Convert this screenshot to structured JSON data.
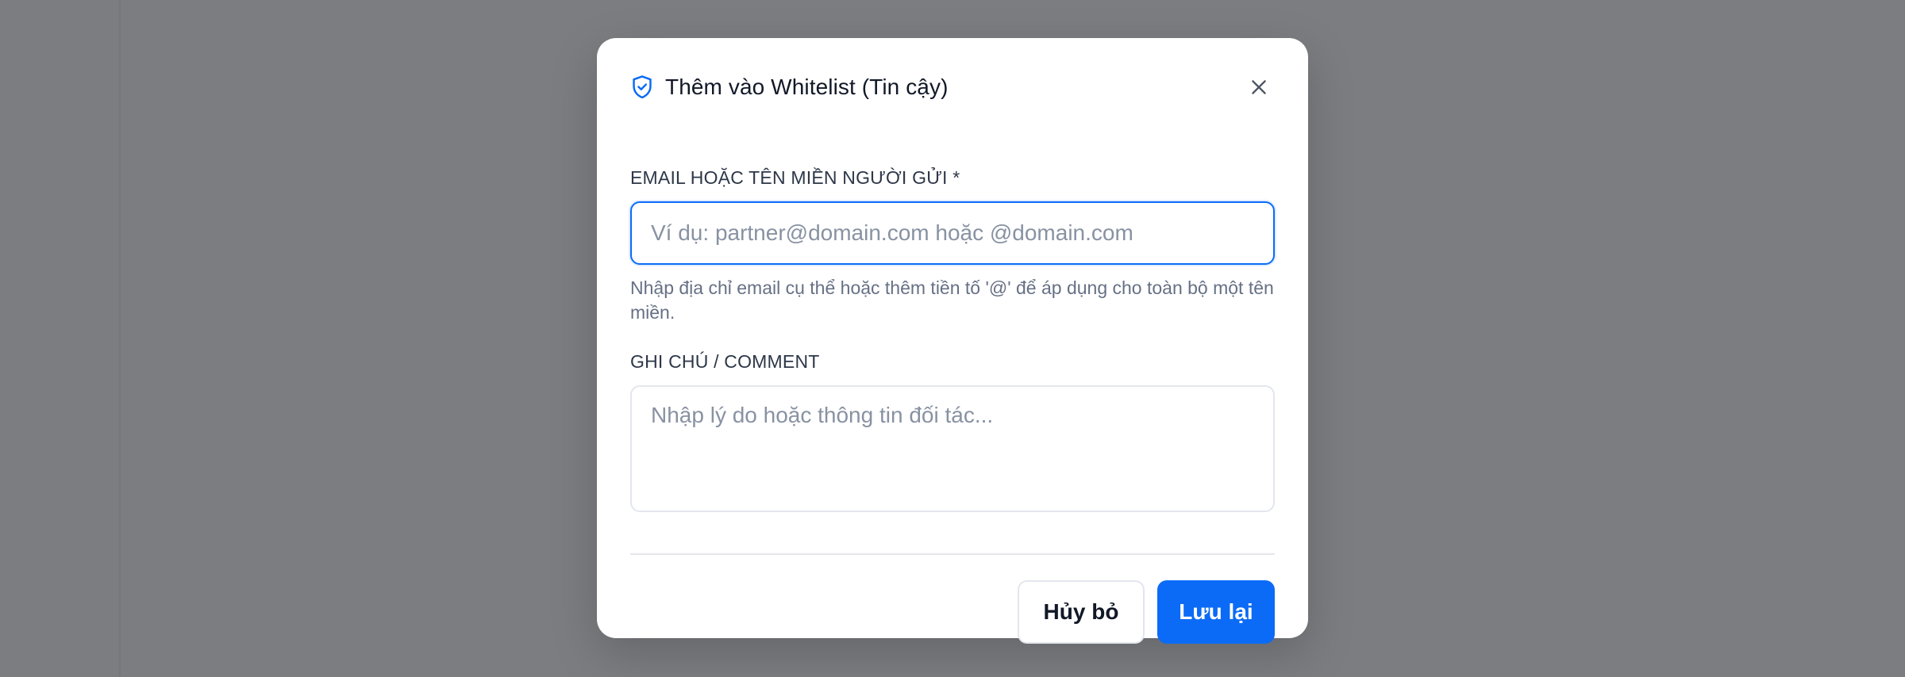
{
  "dialog": {
    "title": "Thêm vào Whitelist (Tin cậy)",
    "icon": "shield-check-icon",
    "close_icon": "close-icon",
    "accent_color": "#0b6bf7"
  },
  "email_field": {
    "label": "EMAIL HOẶC TÊN MIỀN NGƯỜI GỬI *",
    "value": "",
    "placeholder": "Ví dụ: partner@domain.com hoặc @domain.com",
    "hint": "Nhập địa chỉ email cụ thể hoặc thêm tiền tố '@' để áp dụng cho toàn bộ một tên miền."
  },
  "note_field": {
    "label": "GHI CHÚ / COMMENT",
    "value": "",
    "placeholder": "Nhập lý do hoặc thông tin đối tác..."
  },
  "actions": {
    "cancel_label": "Hủy bỏ",
    "save_label": "Lưu lại"
  }
}
